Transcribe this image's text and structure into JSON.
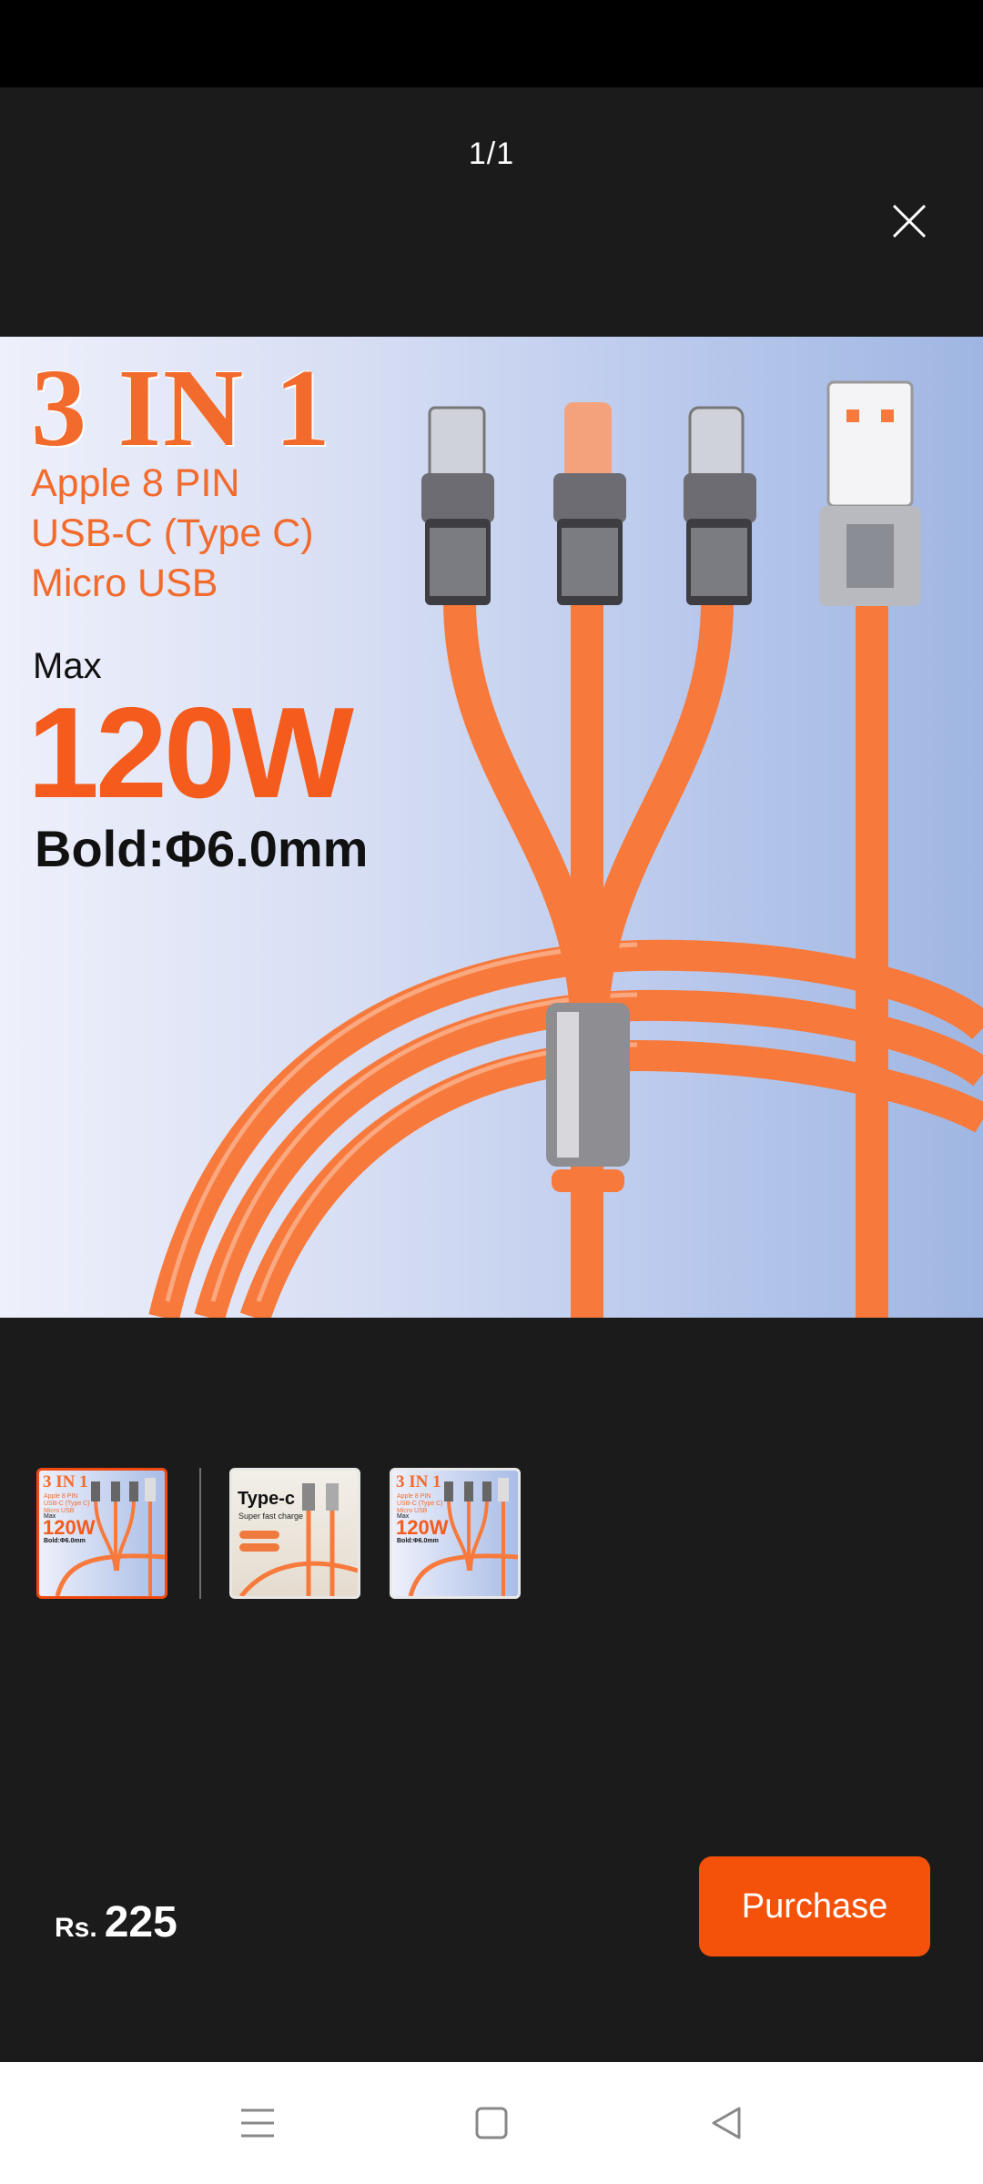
{
  "viewer": {
    "counter": "1/1",
    "close_icon": "close-icon"
  },
  "main_image": {
    "title": "3 IN 1",
    "line1": "Apple 8 PIN",
    "line2": "USB-C (Type C)",
    "line3": "Micro USB",
    "max_label": "Max",
    "wattage": "120W",
    "bold_label": "Bold:Φ6.0mm",
    "colors": {
      "accent": "#f26a2c",
      "cable": "#f77a3c"
    }
  },
  "thumbnails": [
    {
      "title": "3 IN 1",
      "lines": [
        "Apple 8 PIN",
        "USB-C (Type C)",
        "Micro USB"
      ],
      "max": "Max",
      "wattage": "120W",
      "bold": "Bold:Φ6.0mm",
      "active": true
    },
    {
      "title": "Type-c",
      "subtitle": "Super fast charge",
      "active": false
    },
    {
      "title": "3 IN 1",
      "lines": [
        "Apple 8 PIN",
        "USB-C (Type C)",
        "Micro USB"
      ],
      "max": "Max",
      "wattage": "120W",
      "bold": "Bold:Φ6.0mm",
      "active": false
    }
  ],
  "footer": {
    "currency": "Rs.",
    "price": "225",
    "purchase_label": "Purchase",
    "purchase_color": "#f4520a"
  },
  "navbar": {
    "menu_icon": "menu-icon",
    "home_icon": "home-square-icon",
    "back_icon": "back-triangle-icon"
  }
}
